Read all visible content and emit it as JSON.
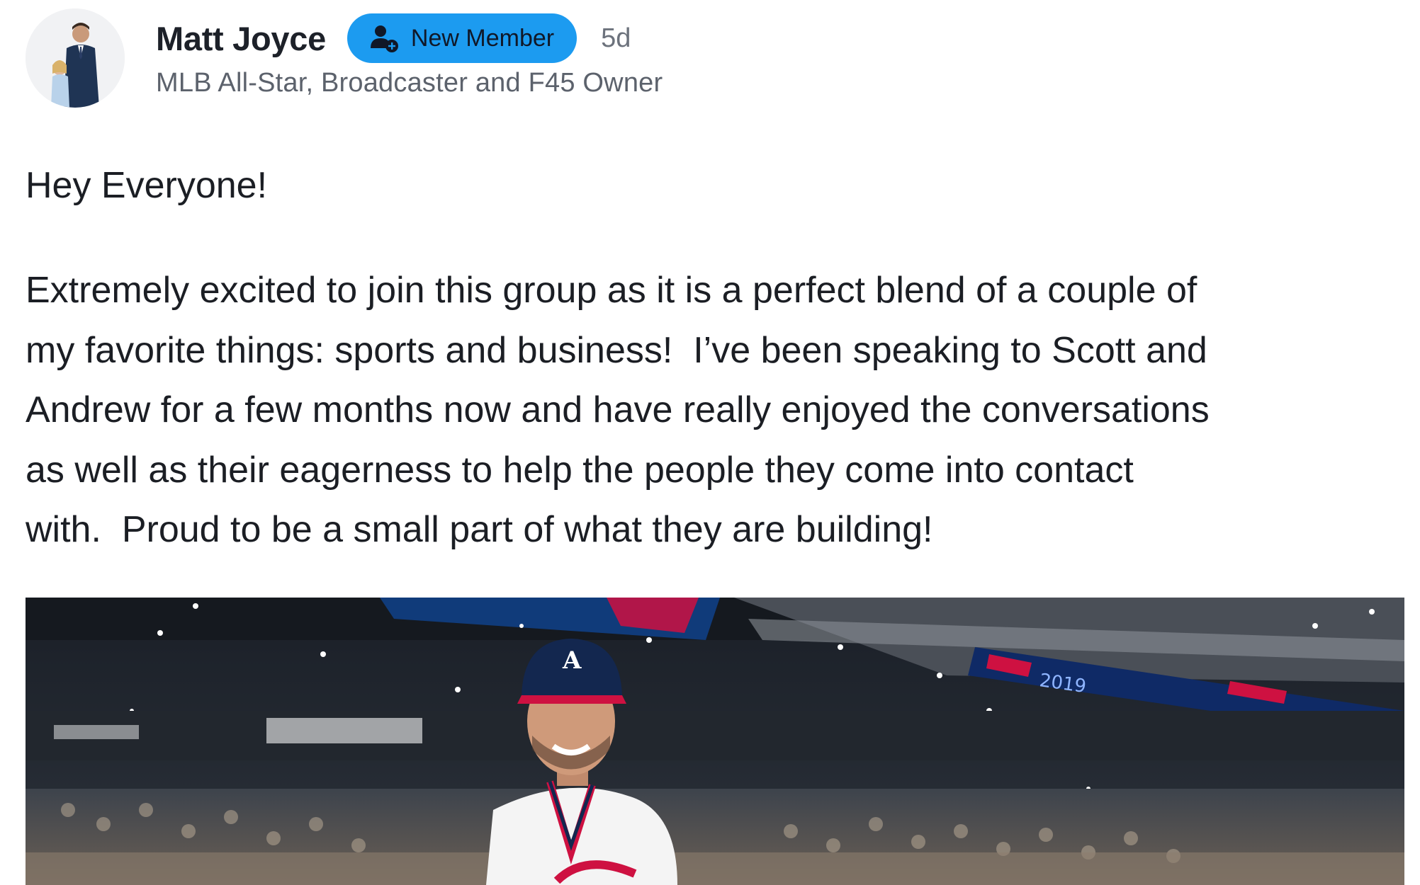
{
  "post": {
    "author": {
      "name": "Matt Joyce",
      "badge_label": "New Member",
      "badge_icon": "user-plus-icon",
      "time_ago": "5d",
      "title": "MLB All-Star, Broadcaster and F45 Owner",
      "avatar_icon": "profile-photo"
    },
    "greeting": "Hey Everyone!",
    "body": "Extremely excited to join this group as it is a perfect blend of a couple of\nmy favorite things: sports and business!  I’ve been speaking to Scott and\nAndrew for a few months now and have really enjoyed the conversations\nas well as their eagerness to help the people they come into contact\nwith.  Proud to be a small part of what they are building!",
    "image": {
      "description_icon": "stadium-photo",
      "scoreboard_text": "2019"
    }
  },
  "colors": {
    "badge_bg": "#1c9bf0",
    "text": "#1b1e24",
    "muted": "#5c626c",
    "braves_navy": "#13274f",
    "braves_red": "#ce1141"
  }
}
